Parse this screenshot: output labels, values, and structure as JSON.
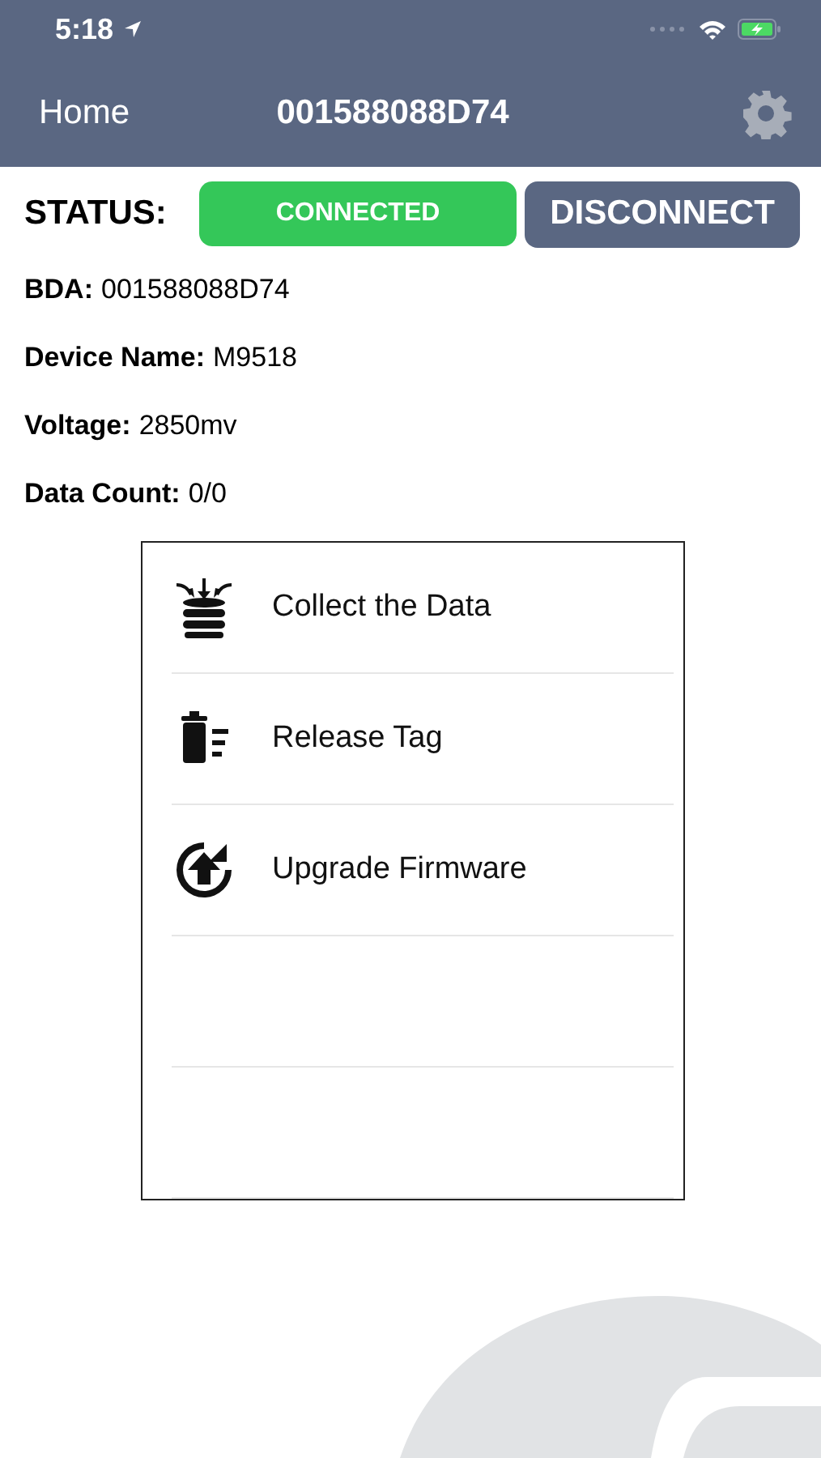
{
  "status_bar": {
    "time": "5:18"
  },
  "nav": {
    "back": "Home",
    "title": "001588088D74"
  },
  "status": {
    "label": "STATUS:",
    "state": "CONNECTED",
    "connected": true,
    "action": "DISCONNECT"
  },
  "info": [
    {
      "label": "BDA:",
      "value": "001588088D74"
    },
    {
      "label": "Device Name:",
      "value": "M9518"
    },
    {
      "label": "Voltage:",
      "value": "2850mv"
    },
    {
      "label": "Data Count:",
      "value": "0/0"
    }
  ],
  "menu": [
    {
      "kind": "collect",
      "label": "Collect the Data"
    },
    {
      "kind": "release",
      "label": "Release Tag"
    },
    {
      "kind": "upgrade",
      "label": "Upgrade Firmware"
    }
  ]
}
